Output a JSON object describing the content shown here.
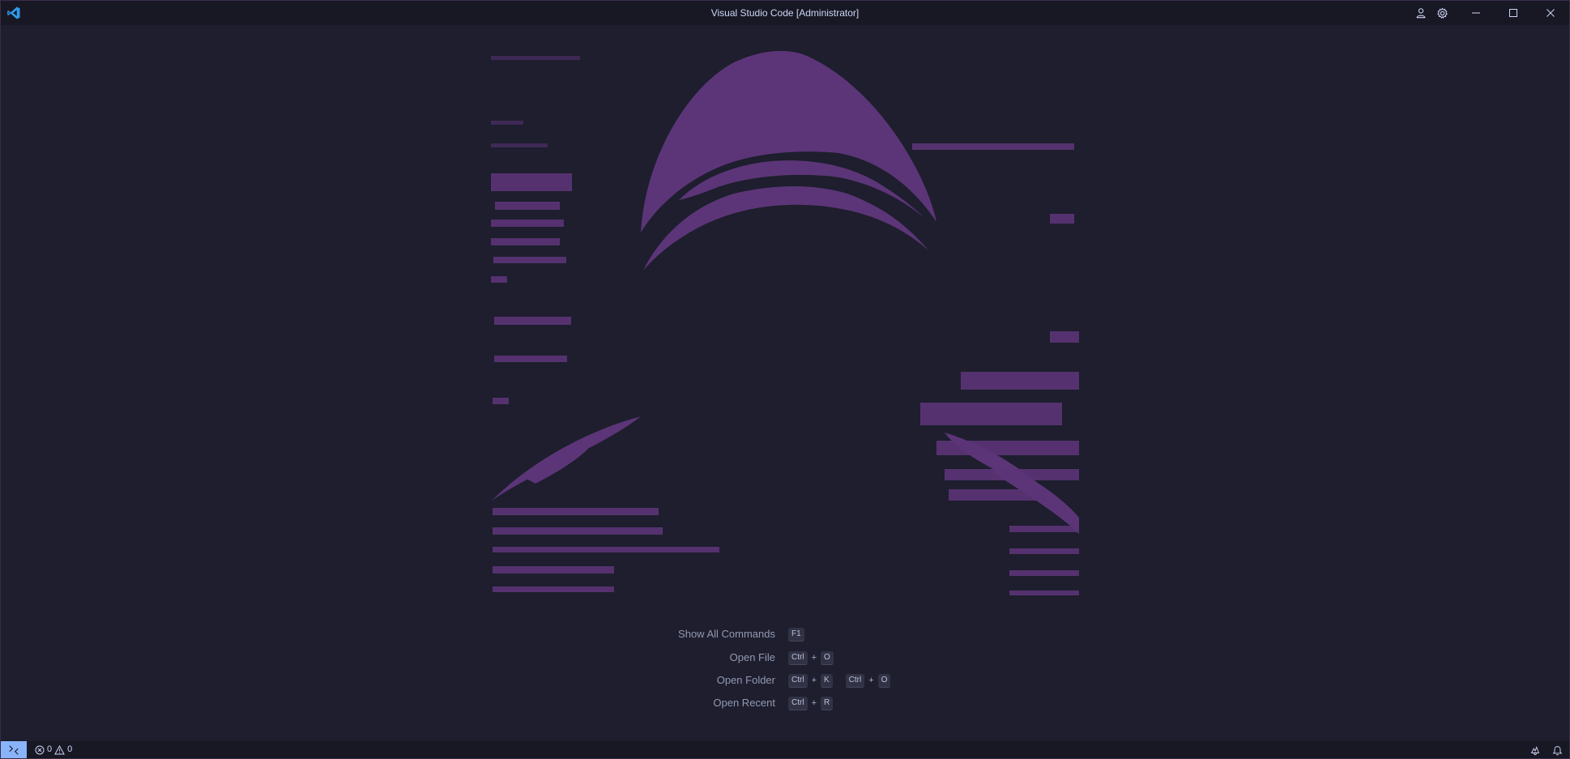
{
  "window": {
    "title": "Visual Studio Code [Administrator]"
  },
  "icons": {
    "app": "vscode-logo",
    "account": "account-icon",
    "settings": "gear-icon",
    "minimize": "minimize-icon",
    "maximize": "maximize-icon",
    "close": "close-icon",
    "remote": "remote-icon",
    "errors": "error-icon",
    "warnings": "warning-icon",
    "copilot": "copilot-icon",
    "notifications": "bell-icon"
  },
  "colors": {
    "background": "#1e1e2e",
    "titlebar": "#181825",
    "watermark": "#6b3a8a",
    "remote_accent": "#89b4fa"
  },
  "shortcuts": [
    {
      "label": "Show All Commands",
      "keys": [
        [
          "F1"
        ]
      ]
    },
    {
      "label": "Open File",
      "keys": [
        [
          "Ctrl",
          "O"
        ]
      ]
    },
    {
      "label": "Open Folder",
      "keys": [
        [
          "Ctrl",
          "K"
        ],
        [
          "Ctrl",
          "O"
        ]
      ]
    },
    {
      "label": "Open Recent",
      "keys": [
        [
          "Ctrl",
          "R"
        ]
      ]
    }
  ],
  "status": {
    "errors": "0",
    "warnings": "0"
  }
}
